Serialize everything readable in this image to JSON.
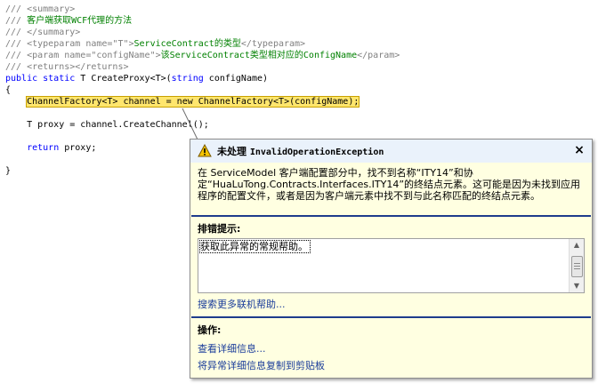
{
  "code": {
    "lines": [
      [
        {
          "t": "/// ",
          "c": "gray"
        },
        {
          "t": "<summary>",
          "c": "gray"
        }
      ],
      [
        {
          "t": "/// ",
          "c": "gray"
        },
        {
          "t": "客户端获取WCF代理的方法",
          "c": "green"
        }
      ],
      [
        {
          "t": "/// ",
          "c": "gray"
        },
        {
          "t": "</summary>",
          "c": "gray"
        }
      ],
      [
        {
          "t": "/// ",
          "c": "gray"
        },
        {
          "t": "<typeparam name=\"T\">",
          "c": "gray"
        },
        {
          "t": "ServiceContract的类型",
          "c": "green"
        },
        {
          "t": "</typeparam>",
          "c": "gray"
        }
      ],
      [
        {
          "t": "/// ",
          "c": "gray"
        },
        {
          "t": "<param name=\"configName\">",
          "c": "gray"
        },
        {
          "t": "该ServiceContract类型相对应的ConfigName",
          "c": "green"
        },
        {
          "t": "</param>",
          "c": "gray"
        }
      ],
      [
        {
          "t": "/// ",
          "c": "gray"
        },
        {
          "t": "<returns></returns>",
          "c": "gray"
        }
      ],
      [
        {
          "t": "public static",
          "c": "blue"
        },
        {
          "t": " T CreateProxy<T>(",
          "c": ""
        },
        {
          "t": "string",
          "c": "blue"
        },
        {
          "t": " configName)",
          "c": ""
        }
      ],
      [
        {
          "t": "{",
          "c": ""
        }
      ],
      [
        {
          "t": "    ",
          "c": ""
        },
        {
          "t": "ChannelFactory<T> channel = new ChannelFactory<T>(configName);",
          "c": "hl"
        }
      ],
      [
        {
          "t": "",
          "c": ""
        }
      ],
      [
        {
          "t": "    T proxy = channel.CreateChannel();",
          "c": ""
        }
      ],
      [
        {
          "t": "",
          "c": ""
        }
      ],
      [
        {
          "t": "    ",
          "c": ""
        },
        {
          "t": "return",
          "c": "blue"
        },
        {
          "t": " proxy;",
          "c": ""
        }
      ],
      [
        {
          "t": "",
          "c": ""
        }
      ],
      [
        {
          "t": "}",
          "c": ""
        }
      ]
    ]
  },
  "popup": {
    "title_prefix": "未处理 ",
    "exception_name": "InvalidOperationException",
    "close_glyph": "×",
    "message": "在 ServiceModel 客户端配置部分中，找不到名称“ITY14”和协定“HuaLuTong.Contracts.Interfaces.ITY14”的终结点元素。这可能是因为未找到应用程序的配置文件，或者是因为客户端元素中找不到与此名称匹配的终结点元素。",
    "troubleshooting_heading": "排错提示:",
    "tips": [
      "获取此异常的常规帮助。"
    ],
    "search_online_link": "搜索更多联机帮助...",
    "actions_heading": "操作:",
    "actions": [
      "查看详细信息...",
      "将异常详细信息复制到剪贴板"
    ]
  },
  "colors": {
    "comment": "#808080",
    "comment_text": "#008000",
    "keyword": "#0000ff",
    "highlight": "#ffe66d",
    "popup_bg": "#ffffe1",
    "link": "#1a3c9a",
    "separator": "#1e3c8c"
  },
  "icons": {
    "warning": "warning-icon",
    "close": "close-icon"
  }
}
